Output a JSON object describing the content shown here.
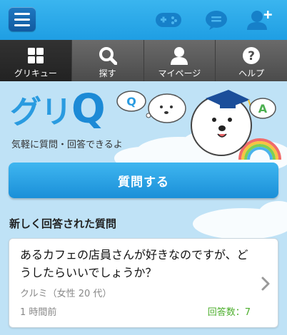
{
  "header": {
    "menu_icon": "hamburger-icon",
    "icons": [
      "gamepad-icon",
      "chat-bubble-icon",
      "add-user-icon"
    ]
  },
  "tabs": [
    {
      "label": "グリキュー",
      "icon": "grid-icon",
      "active": true
    },
    {
      "label": "探す",
      "icon": "search-icon",
      "active": false
    },
    {
      "label": "マイページ",
      "icon": "user-icon",
      "active": false
    },
    {
      "label": "ヘルプ",
      "icon": "help-icon",
      "active": false
    }
  ],
  "hero": {
    "logo_text_a": "グリ",
    "logo_text_b": "Q",
    "bubble_q": "Q",
    "bubble_a": "A",
    "tagline": "気軽に質問・回答できるよ"
  },
  "ask_button": "質問する",
  "section_title": "新しく回答された質問",
  "question": {
    "text": "あるカフェの店員さんが好きなのですが、どうしたらいいでしょうか？",
    "asker": "クルミ（女性 20 代）",
    "time": "1 時間前",
    "answers": "回答数：7"
  },
  "colors": {
    "header_blue": "#27a7e8",
    "tab_dark": "#4b4b4b",
    "background": "#bfe2f6",
    "answer_green": "#4cae2c"
  }
}
